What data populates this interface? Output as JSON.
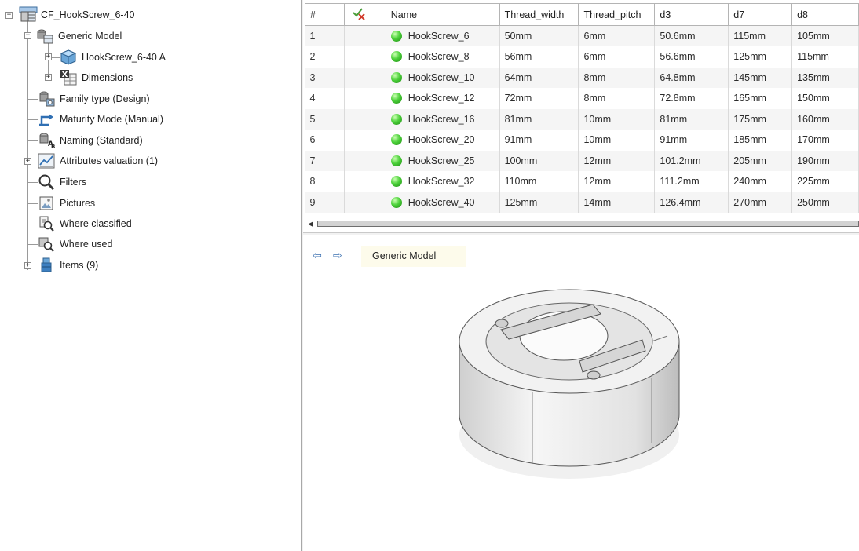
{
  "tree": {
    "root": "CF_HookScrew_6-40",
    "generic_model": "Generic Model",
    "hookscrew_a": "HookScrew_6-40 A",
    "dimensions": "Dimensions",
    "family_type": "Family type (Design)",
    "maturity": "Maturity Mode (Manual)",
    "naming": "Naming (Standard)",
    "attributes": "Attributes valuation (1)",
    "filters": "Filters",
    "pictures": "Pictures",
    "where_classified": "Where classified",
    "where_used": "Where used",
    "items": "Items (9)"
  },
  "table": {
    "headers": {
      "num": "#",
      "status": "",
      "name": "Name",
      "thread_width": "Thread_width",
      "thread_pitch": "Thread_pitch",
      "d3": "d3",
      "d7": "d7",
      "d8": "d8"
    },
    "rows": [
      {
        "num": "1",
        "name": "HookScrew_6",
        "tw": "50mm",
        "tp": "6mm",
        "d3": "50.6mm",
        "d7": "115mm",
        "d8": "105mm"
      },
      {
        "num": "2",
        "name": "HookScrew_8",
        "tw": "56mm",
        "tp": "6mm",
        "d3": "56.6mm",
        "d7": "125mm",
        "d8": "115mm"
      },
      {
        "num": "3",
        "name": "HookScrew_10",
        "tw": "64mm",
        "tp": "8mm",
        "d3": "64.8mm",
        "d7": "145mm",
        "d8": "135mm"
      },
      {
        "num": "4",
        "name": "HookScrew_12",
        "tw": "72mm",
        "tp": "8mm",
        "d3": "72.8mm",
        "d7": "165mm",
        "d8": "150mm"
      },
      {
        "num": "5",
        "name": "HookScrew_16",
        "tw": "81mm",
        "tp": "10mm",
        "d3": "81mm",
        "d7": "175mm",
        "d8": "160mm"
      },
      {
        "num": "6",
        "name": "HookScrew_20",
        "tw": "91mm",
        "tp": "10mm",
        "d3": "91mm",
        "d7": "185mm",
        "d8": "170mm"
      },
      {
        "num": "7",
        "name": "HookScrew_25",
        "tw": "100mm",
        "tp": "12mm",
        "d3": "101.2mm",
        "d7": "205mm",
        "d8": "190mm"
      },
      {
        "num": "8",
        "name": "HookScrew_32",
        "tw": "110mm",
        "tp": "12mm",
        "d3": "111.2mm",
        "d7": "240mm",
        "d8": "225mm"
      },
      {
        "num": "9",
        "name": "HookScrew_40",
        "tw": "125mm",
        "tp": "14mm",
        "d3": "126.4mm",
        "d7": "270mm",
        "d8": "250mm"
      }
    ]
  },
  "preview": {
    "breadcrumb": "Generic Model"
  },
  "colors": {
    "status_green": "#3cc42c",
    "breadcrumb_bg": "#fdfbeb",
    "nav_arrow": "#3a6fb0"
  },
  "icons": {
    "root": "catalog-icon",
    "generic_model": "catalog-chapter-icon",
    "hookscrew_a": "part-cube-icon",
    "dimensions": "excel-table-icon",
    "family_type": "family-type-icon",
    "maturity": "maturity-arrow-icon",
    "naming": "naming-icon",
    "attributes": "attributes-chart-icon",
    "filters": "magnifier-icon",
    "pictures": "picture-icon",
    "where_classified": "where-classified-icon",
    "where_used": "where-used-icon",
    "items": "items-icon"
  }
}
